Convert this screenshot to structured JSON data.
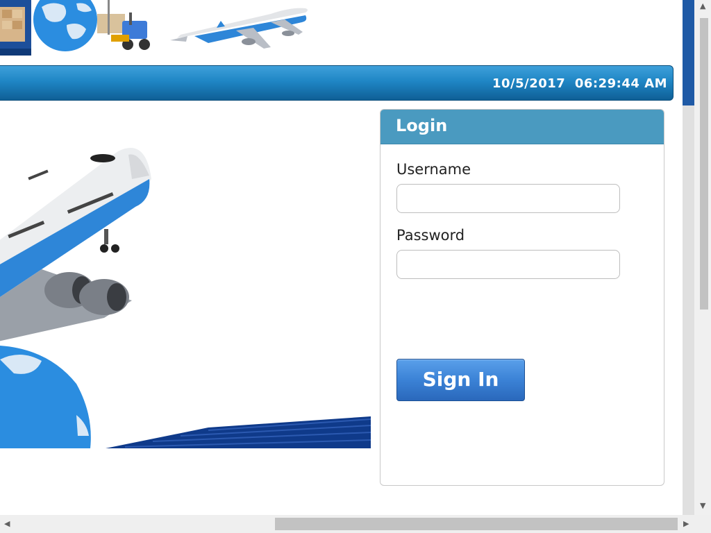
{
  "header": {
    "datetime": "10/5/2017  06:29:44 AM"
  },
  "login": {
    "title": "Login",
    "username_label": "Username",
    "username_value": "",
    "password_label": "Password",
    "password_value": "",
    "signin_label": "Sign In"
  },
  "colors": {
    "statusbar_blue": "#1f86c5",
    "login_header": "#4a9ac0",
    "signin_button": "#3b82d6"
  }
}
